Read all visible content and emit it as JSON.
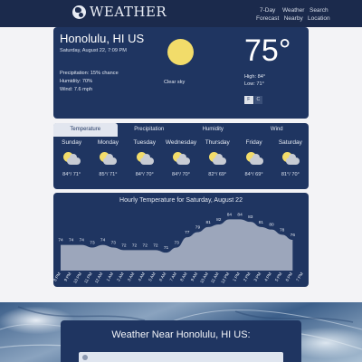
{
  "brand": {
    "name": "WEATHER",
    "icon": "globe-icon"
  },
  "nav": [
    {
      "line1": "7-Day",
      "line2": "Forecast"
    },
    {
      "line1": "Weather",
      "line2": "Nearby"
    },
    {
      "line1": "Search",
      "line2": "Location"
    }
  ],
  "current": {
    "city": "Honolulu, HI US",
    "date": "Saturday, August 22, 7:09 PM",
    "precipitation": "Precipitation: 15% chance",
    "humidity": "Humidity: 70%",
    "wind": "Wind: 7.6 mph",
    "icon": "sun-icon",
    "description": "Clear sky",
    "temperature": "75°",
    "high": "High: 84°",
    "low": "Low: 71°",
    "unit_options": [
      "F",
      "C"
    ]
  },
  "forecast_tabs": [
    "Temperature",
    "Precipitation",
    "Humidity",
    "Wind"
  ],
  "forecast_days": [
    {
      "day": "Sunday",
      "temps": "84°/ 71°",
      "icon": "partly-cloudy-icon"
    },
    {
      "day": "Monday",
      "temps": "85°/ 71°",
      "icon": "partly-cloudy-icon"
    },
    {
      "day": "Tuesday",
      "temps": "84°/ 70°",
      "icon": "partly-cloudy-icon"
    },
    {
      "day": "Wednesday",
      "temps": "84°/ 70°",
      "icon": "partly-cloudy-icon"
    },
    {
      "day": "Thursday",
      "temps": "82°/ 69°",
      "icon": "partly-cloudy-icon"
    },
    {
      "day": "Friday",
      "temps": "84°/ 69°",
      "icon": "partly-cloudy-icon"
    },
    {
      "day": "Saturday",
      "temps": "81°/ 70°",
      "icon": "partly-cloudy-icon"
    }
  ],
  "colors": {
    "card": "#1f3561",
    "topbar": "#1b2a4c",
    "area_fill": "#9ca6bb",
    "sun": "#f2dc6a"
  },
  "chart_data": {
    "type": "area",
    "title": "Hourly Temperature for Saturday, August 22",
    "categories": [
      "8 PM",
      "9 PM",
      "10 PM",
      "11 PM",
      "12 AM",
      "1 AM",
      "2 AM",
      "3 AM",
      "4 AM",
      "5 AM",
      "6 AM",
      "7 AM",
      "8 AM",
      "9 AM",
      "10 AM",
      "11 AM",
      "12 PM",
      "1 PM",
      "2 PM",
      "3 PM",
      "4 PM",
      "5 PM",
      "6 PM",
      "7 PM"
    ],
    "values": [
      74,
      74,
      74,
      73,
      74,
      73,
      72,
      72,
      72,
      72,
      71,
      73,
      77,
      79,
      81,
      82,
      84,
      84,
      83,
      81,
      80,
      78,
      76,
      null
    ],
    "value_labels": [
      "74",
      "74",
      "74",
      "73",
      "74",
      "73",
      "72",
      "72",
      "72",
      "72",
      "71",
      "73",
      "77",
      "79",
      "81",
      "82",
      "84",
      "84",
      "83",
      "81",
      "80",
      "78",
      "76",
      ""
    ],
    "ylim": [
      64,
      88
    ],
    "grid": false
  },
  "nearby": {
    "title": "Weather Near Honolulu, HI US:"
  }
}
